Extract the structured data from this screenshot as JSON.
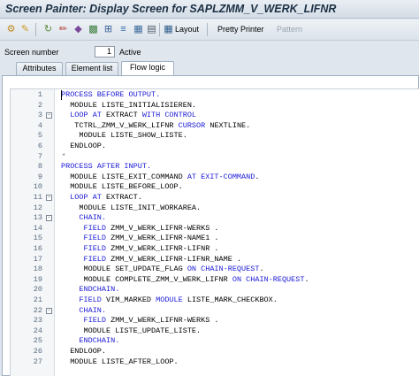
{
  "window": {
    "title": "Screen Painter: Display Screen for SAPLZMM_V_WERK_LIFNR"
  },
  "toolbar": {
    "icons": [
      "transport-icon",
      "other-object-icon",
      "display-change-icon",
      "edit-pencil-icon",
      "check-icon",
      "where-used-icon",
      "hierarchy-icon",
      "activate-icon",
      "test-icon",
      "object-list-icon",
      "tree-icon",
      "layout-icon"
    ],
    "layout_label": "Layout",
    "pretty_printer_label": "Pretty Printer",
    "pattern_label": "Pattern"
  },
  "screen": {
    "label": "Screen number",
    "number": "1",
    "status": "Active"
  },
  "tabs": [
    {
      "label": "Attributes"
    },
    {
      "label": "Element list"
    },
    {
      "label": "Flow logic"
    }
  ],
  "code_lines": [
    {
      "n": "1",
      "fold": "",
      "parts": [
        [
          "kw",
          "PROCESS BEFORE OUTPUT."
        ]
      ]
    },
    {
      "n": "2",
      "fold": "",
      "parts": [
        [
          "",
          "  MODULE LISTE_INITIALISIEREN."
        ]
      ]
    },
    {
      "n": "3",
      "fold": "-",
      "parts": [
        [
          "kw",
          "  LOOP AT "
        ],
        [
          "",
          "EXTRACT "
        ],
        [
          "kw",
          "WITH CONTROL"
        ]
      ]
    },
    {
      "n": "4",
      "fold": "",
      "parts": [
        [
          "",
          "   TCTRL_ZMM_V_WERK_LIFNR "
        ],
        [
          "kw",
          "CURSOR "
        ],
        [
          "",
          "NEXTLINE."
        ]
      ]
    },
    {
      "n": "5",
      "fold": "",
      "parts": [
        [
          "",
          "    MODULE LISTE_SHOW_LISTE."
        ]
      ]
    },
    {
      "n": "6",
      "fold": "",
      "parts": [
        [
          "",
          "  ENDLOOP."
        ]
      ]
    },
    {
      "n": "7",
      "fold": "",
      "parts": [
        [
          "cm",
          "*"
        ]
      ]
    },
    {
      "n": "8",
      "fold": "",
      "parts": [
        [
          "kw",
          "PROCESS AFTER INPUT."
        ]
      ]
    },
    {
      "n": "9",
      "fold": "",
      "parts": [
        [
          "",
          "  MODULE LISTE_EXIT_COMMAND "
        ],
        [
          "kw",
          "AT EXIT-COMMAND"
        ],
        [
          "",
          "."
        ]
      ]
    },
    {
      "n": "10",
      "fold": "",
      "parts": [
        [
          "",
          "  MODULE LISTE_BEFORE_LOOP."
        ]
      ]
    },
    {
      "n": "11",
      "fold": "-",
      "parts": [
        [
          "kw",
          "  LOOP AT "
        ],
        [
          "",
          "EXTRACT."
        ]
      ]
    },
    {
      "n": "12",
      "fold": "",
      "parts": [
        [
          "",
          "    MODULE LISTE_INIT_WORKAREA."
        ]
      ]
    },
    {
      "n": "13",
      "fold": "-",
      "parts": [
        [
          "kw",
          "    CHAIN."
        ]
      ]
    },
    {
      "n": "14",
      "fold": "",
      "parts": [
        [
          "kw",
          "     FIELD "
        ],
        [
          "",
          "ZMM_V_WERK_LIFNR-WERKS ."
        ]
      ]
    },
    {
      "n": "15",
      "fold": "",
      "parts": [
        [
          "kw",
          "     FIELD "
        ],
        [
          "",
          "ZMM_V_WERK_LIFNR-NAME1 ."
        ]
      ]
    },
    {
      "n": "16",
      "fold": "",
      "parts": [
        [
          "kw",
          "     FIELD "
        ],
        [
          "",
          "ZMM_V_WERK_LIFNR-LIFNR ."
        ]
      ]
    },
    {
      "n": "17",
      "fold": "",
      "parts": [
        [
          "kw",
          "     FIELD "
        ],
        [
          "",
          "ZMM_V_WERK_LIFNR-LIFNR_NAME ."
        ]
      ]
    },
    {
      "n": "18",
      "fold": "",
      "parts": [
        [
          "",
          "     MODULE SET_UPDATE_FLAG "
        ],
        [
          "kw",
          "ON CHAIN-REQUEST"
        ],
        [
          "",
          "."
        ]
      ]
    },
    {
      "n": "19",
      "fold": "",
      "parts": [
        [
          "",
          "     MODULE COMPLETE_ZMM_V_WERK_LIFNR "
        ],
        [
          "kw",
          "ON CHAIN-REQUEST"
        ],
        [
          "",
          "."
        ]
      ]
    },
    {
      "n": "20",
      "fold": "",
      "parts": [
        [
          "kw",
          "    ENDCHAIN."
        ]
      ]
    },
    {
      "n": "21",
      "fold": "",
      "parts": [
        [
          "kw",
          "    FIELD "
        ],
        [
          "",
          "VIM_MARKED "
        ],
        [
          "kw",
          "MODULE "
        ],
        [
          "",
          "LISTE_MARK_CHECKBOX."
        ]
      ]
    },
    {
      "n": "22",
      "fold": "-",
      "parts": [
        [
          "kw",
          "    CHAIN."
        ]
      ]
    },
    {
      "n": "23",
      "fold": "",
      "parts": [
        [
          "kw",
          "     FIELD "
        ],
        [
          "",
          "ZMM_V_WERK_LIFNR-WERKS ."
        ]
      ]
    },
    {
      "n": "24",
      "fold": "",
      "parts": [
        [
          "",
          "     MODULE LISTE_UPDATE_LISTE."
        ]
      ]
    },
    {
      "n": "25",
      "fold": "",
      "parts": [
        [
          "kw",
          "    ENDCHAIN."
        ]
      ]
    },
    {
      "n": "26",
      "fold": "",
      "parts": [
        [
          "",
          "  ENDLOOP."
        ]
      ]
    },
    {
      "n": "27",
      "fold": "",
      "parts": [
        [
          "",
          "  MODULE LISTE_AFTER_LOOP."
        ]
      ]
    }
  ],
  "colors": {
    "keyword": "#1a1ad6",
    "comment": "#6a7e92",
    "title": "#1b2f44"
  }
}
